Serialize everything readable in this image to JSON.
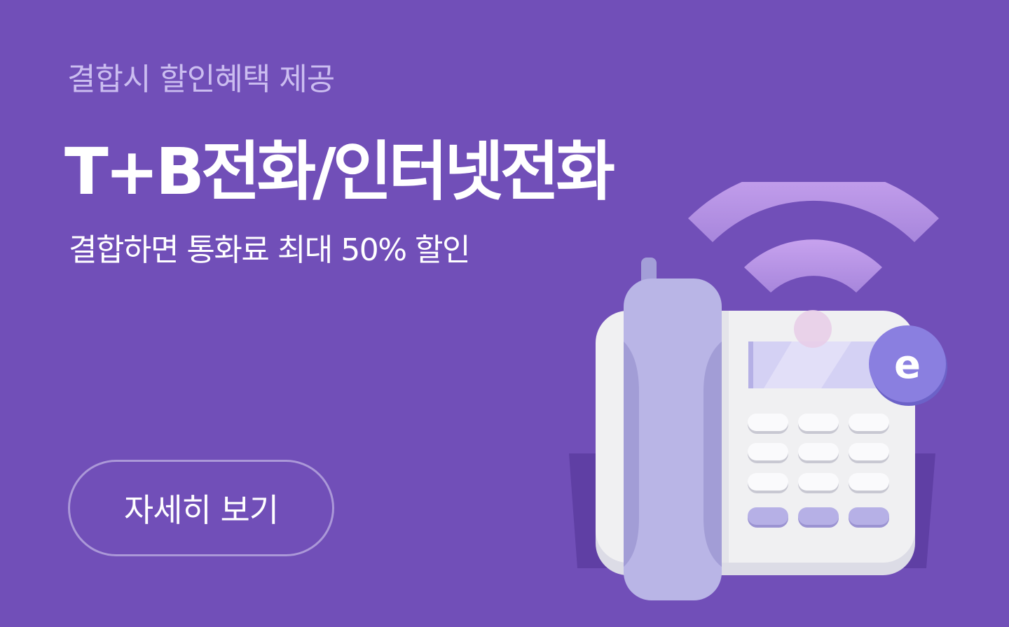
{
  "banner": {
    "eyebrow": "결합시 할인혜택 제공",
    "headline": "T+B전화/인터넷전화",
    "subline": "결합하면 통화료 최대 50% 할인",
    "cta_label": "자세히 보기",
    "badge_letter": "e"
  },
  "colors": {
    "background": "#714fb8",
    "eyebrow_text": "#cbbdf0",
    "text": "#ffffff",
    "cta_border": "#ab98d8",
    "handset": "#b9b5e6",
    "phone_body": "#f0f0f2",
    "badge": "#8a7fe0",
    "signal": "#c39ae8"
  },
  "icons": {
    "illustration": "desk-phone-illustration",
    "signal": "wifi-signal-icon",
    "badge": "e-badge-icon"
  }
}
